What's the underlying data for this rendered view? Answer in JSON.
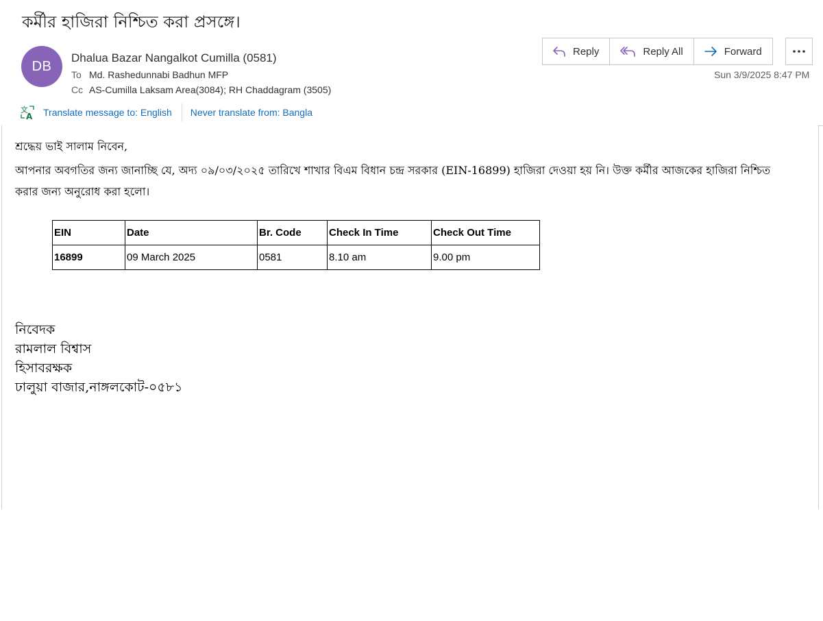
{
  "email": {
    "subject": "কর্মীর হাজিরা নিশ্চিত করা প্রসঙ্গে।",
    "avatar_initials": "DB",
    "avatar_color": "#8764b8",
    "sender": "Dhalua Bazar Nangalkot Cumilla (0581)",
    "to_label": "To",
    "to_value": "Md. Rashedunnabi Badhun MFP",
    "cc_label": "Cc",
    "cc_value": "AS-Cumilla Laksam Area(3084); RH Chaddagram (3505)",
    "timestamp": "Sun 3/9/2025 8:47 PM"
  },
  "actions": {
    "reply": "Reply",
    "reply_all": "Reply All",
    "forward": "Forward",
    "more_icon": "more-horizontal-icon"
  },
  "translate": {
    "translate_label": "Translate message to: English",
    "never_label": "Never translate from: Bangla",
    "link_color": "#0f6cbd"
  },
  "body": {
    "greeting": "শ্রদ্ধেয় ভাই সালাম নিবেন,",
    "para_line1": "আপনার অবগতির জন্য জানাচ্ছি যে, অদ্য ০৯/০৩/২০২৫ তারিখে শাখার বিএম বিধান চন্দ্র সরকার (EIN-16899) হাজিরা দেওয়া হয় নি।  উক্ত কর্মীর আজকের হাজিরা নিশ্চিত",
    "para_line2": "করার জন্য অনুরোধ করা হলো।"
  },
  "table": {
    "headers": [
      "EIN",
      "Date",
      "Br. Code",
      "Check In Time",
      "Check Out Time"
    ],
    "rows": [
      [
        "16899",
        "09 March 2025",
        "0581",
        "8.10 am",
        "9.00 pm"
      ]
    ]
  },
  "signature": {
    "line1": "নিবেদক",
    "line2": "রামলাল বিশ্বাস",
    "line3": "হিসাবরক্ষক",
    "line4": "ঢালুয়া বাজার,নাঙ্গলকোট-০৫৮১"
  }
}
